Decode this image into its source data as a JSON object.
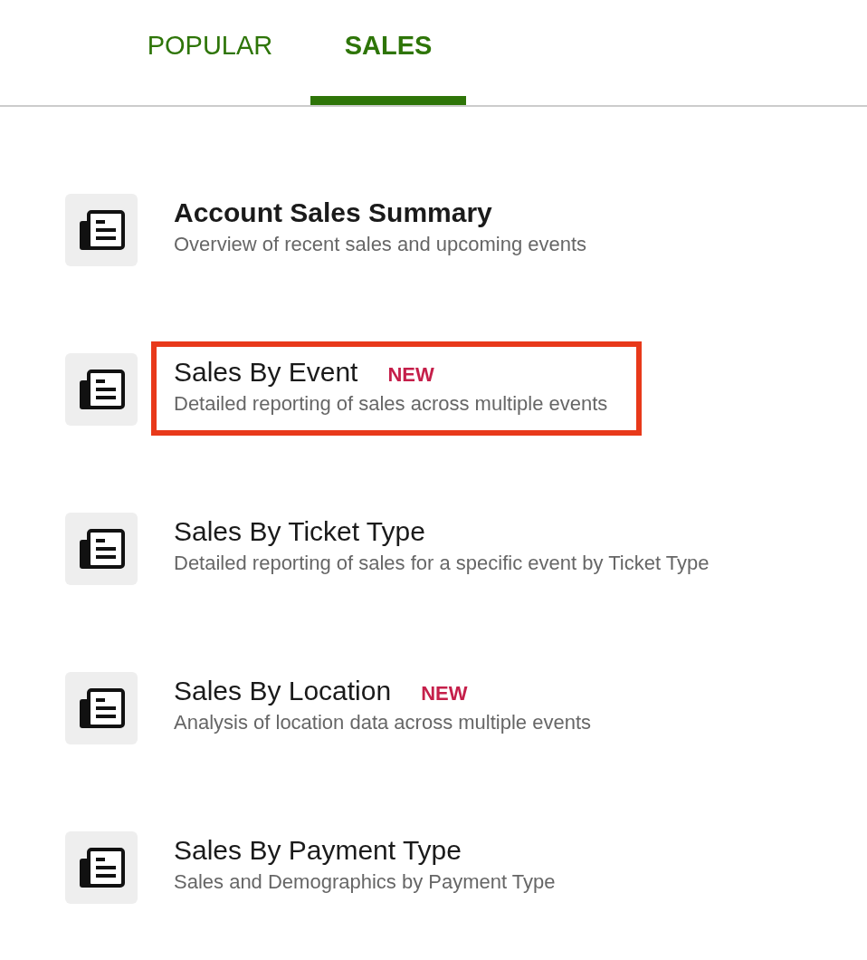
{
  "tabs": [
    {
      "label": "POPULAR",
      "selected": false
    },
    {
      "label": "SALES",
      "selected": true
    }
  ],
  "reports": [
    {
      "title": "Account Sales Summary",
      "description": "Overview of recent sales and upcoming events",
      "emphasized": true,
      "highlighted": false
    },
    {
      "title": "Sales By Event",
      "badge": "NEW",
      "description": "Detailed reporting of sales across multiple events",
      "emphasized": false,
      "highlighted": true
    },
    {
      "title": "Sales By Ticket Type",
      "description": "Detailed reporting of sales for a specific event by Ticket Type",
      "emphasized": false,
      "highlighted": false
    },
    {
      "title": "Sales By Location",
      "badge": "NEW",
      "description": "Analysis of location data across multiple events",
      "emphasized": false,
      "highlighted": false
    },
    {
      "title": "Sales By Payment Type",
      "description": "Sales and Demographics by Payment Type",
      "emphasized": false,
      "highlighted": false
    }
  ]
}
